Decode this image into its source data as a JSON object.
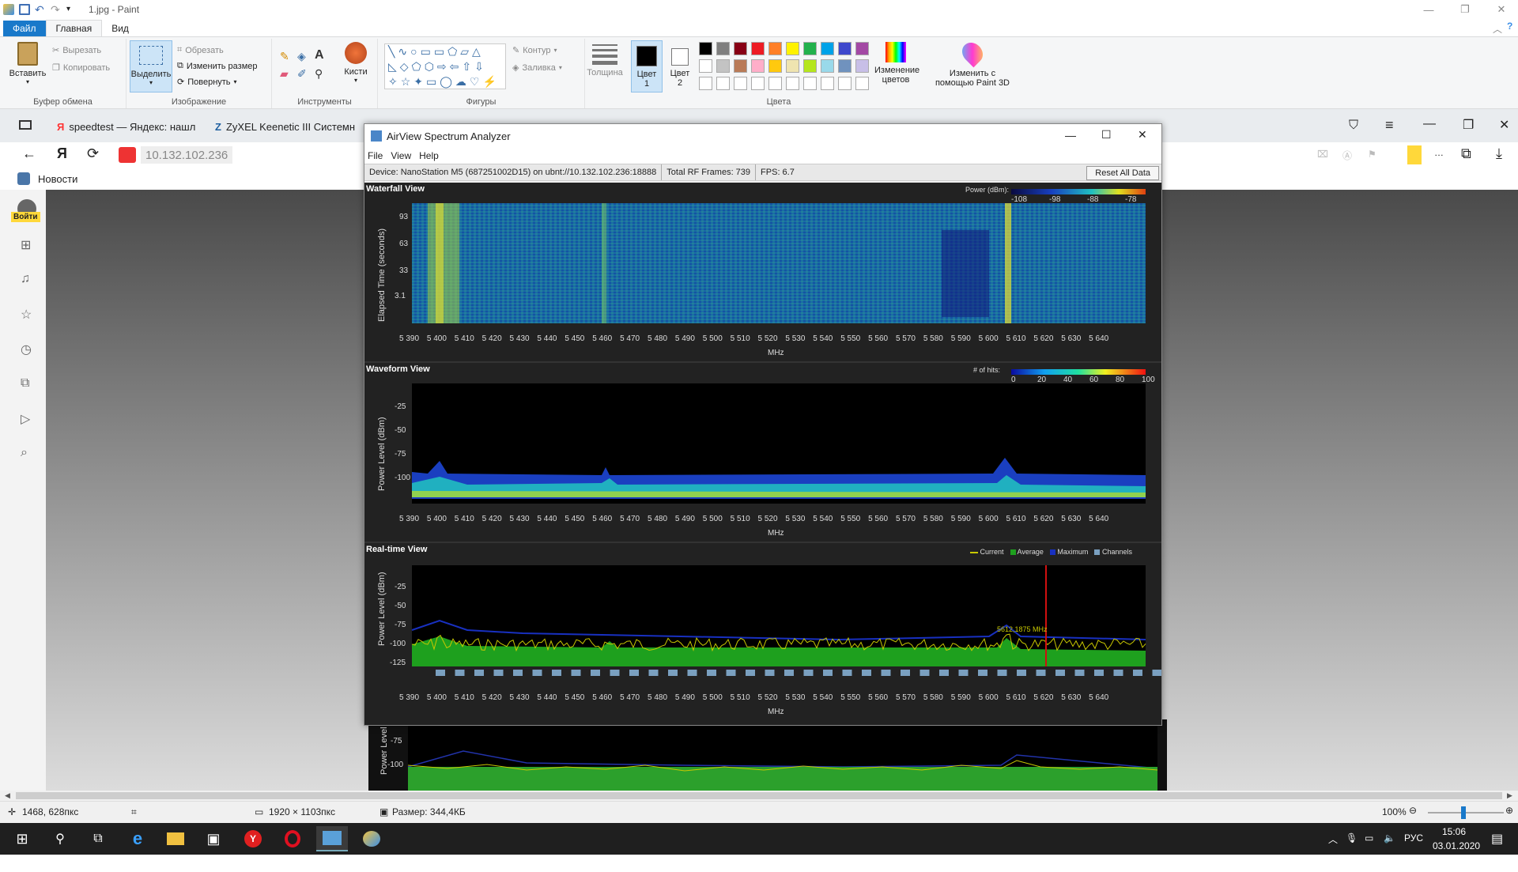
{
  "paint": {
    "title": "1.jpg - Paint",
    "tabs": [
      "Файл",
      "Главная",
      "Вид"
    ],
    "clipboard": {
      "paste": "Вставить",
      "cut": "Вырезать",
      "copy": "Копировать",
      "group": "Буфер обмена"
    },
    "image": {
      "select": "Выделить",
      "crop": "Обрезать",
      "resize": "Изменить размер",
      "rotate": "Повернуть",
      "group": "Изображение"
    },
    "tools": {
      "brushes": "Кисти",
      "group": "Инструменты"
    },
    "shapes": {
      "outline": "Контур",
      "fill": "Заливка",
      "group": "Фигуры"
    },
    "size": "Толщина",
    "color1": "Цвет 1",
    "color2": "Цвет 2",
    "edit_colors": "Изменение цветов",
    "paint3d": "Изменить с помощью Paint 3D",
    "colors_group": "Цвета",
    "palette": [
      "#000000",
      "#7f7f7f",
      "#880015",
      "#ed1c24",
      "#ff7f27",
      "#fff200",
      "#22b14c",
      "#00a2e8",
      "#3f48cc",
      "#a349a4",
      "#ffffff",
      "#c3c3c3",
      "#b97a57",
      "#ffaec9",
      "#ffc90e",
      "#efe4b0",
      "#b5e61d",
      "#99d9ea",
      "#7092be",
      "#c8bfe7"
    ],
    "status": {
      "cursor": "1468, 628пкс",
      "dimensions": "1920 × 1103пкс",
      "size": "Размер: 344,4КБ",
      "zoom": "100%"
    }
  },
  "browser": {
    "tabs": [
      "speedtest — Яндекс: нашл",
      "ZyXEL Keenetic III Системн"
    ],
    "address": "10.132.102.236",
    "bookmark": "Новости",
    "login": "Войти"
  },
  "airview": {
    "title": "AirView Spectrum Analyzer",
    "menu": [
      "File",
      "View",
      "Help"
    ],
    "device": "Device: NanoStation M5 (687251002D15) on ubnt://10.132.102.236:18888",
    "frames": "Total RF Frames: 739",
    "fps": "FPS: 6.7",
    "reset": "Reset All Data",
    "mhz": "MHz",
    "x_ticks": [
      "5 390",
      "5 400",
      "5 410",
      "5 420",
      "5 430",
      "5 440",
      "5 450",
      "5 460",
      "5 470",
      "5 480",
      "5 490",
      "5 500",
      "5 510",
      "5 520",
      "5 530",
      "5 540",
      "5 550",
      "5 560",
      "5 570",
      "5 580",
      "5 590",
      "5 600",
      "5 610",
      "5 620",
      "5 630",
      "5 640"
    ],
    "waterfall": {
      "title": "Waterfall View",
      "ylabel": "Elapsed Time (seconds)",
      "yticks": [
        "93",
        "63",
        "33",
        "3.1"
      ],
      "legend": "Power (dBm):",
      "legend_ticks": [
        "-108",
        "-98",
        "-88",
        "-78"
      ]
    },
    "waveform": {
      "title": "Waveform View",
      "ylabel": "Power Level (dBm)",
      "yticks": [
        "-25",
        "-50",
        "-75",
        "-100"
      ],
      "legend": "# of hits:",
      "legend_ticks": [
        "0",
        "20",
        "40",
        "60",
        "80",
        "100"
      ]
    },
    "realtime": {
      "title": "Real-time View",
      "ylabel": "Power Level (dBm)",
      "yticks": [
        "-25",
        "-50",
        "-75",
        "-100",
        "-125"
      ],
      "legend": [
        "Current",
        "Average",
        "Maximum",
        "Channels"
      ],
      "marker": "5612,1875 MHz"
    },
    "extra": {
      "ylabel": "Power Level",
      "yticks": [
        "-75",
        "-100"
      ]
    }
  },
  "taskbar": {
    "lang": "РУС",
    "time": "15:06",
    "date": "03.01.2020"
  }
}
